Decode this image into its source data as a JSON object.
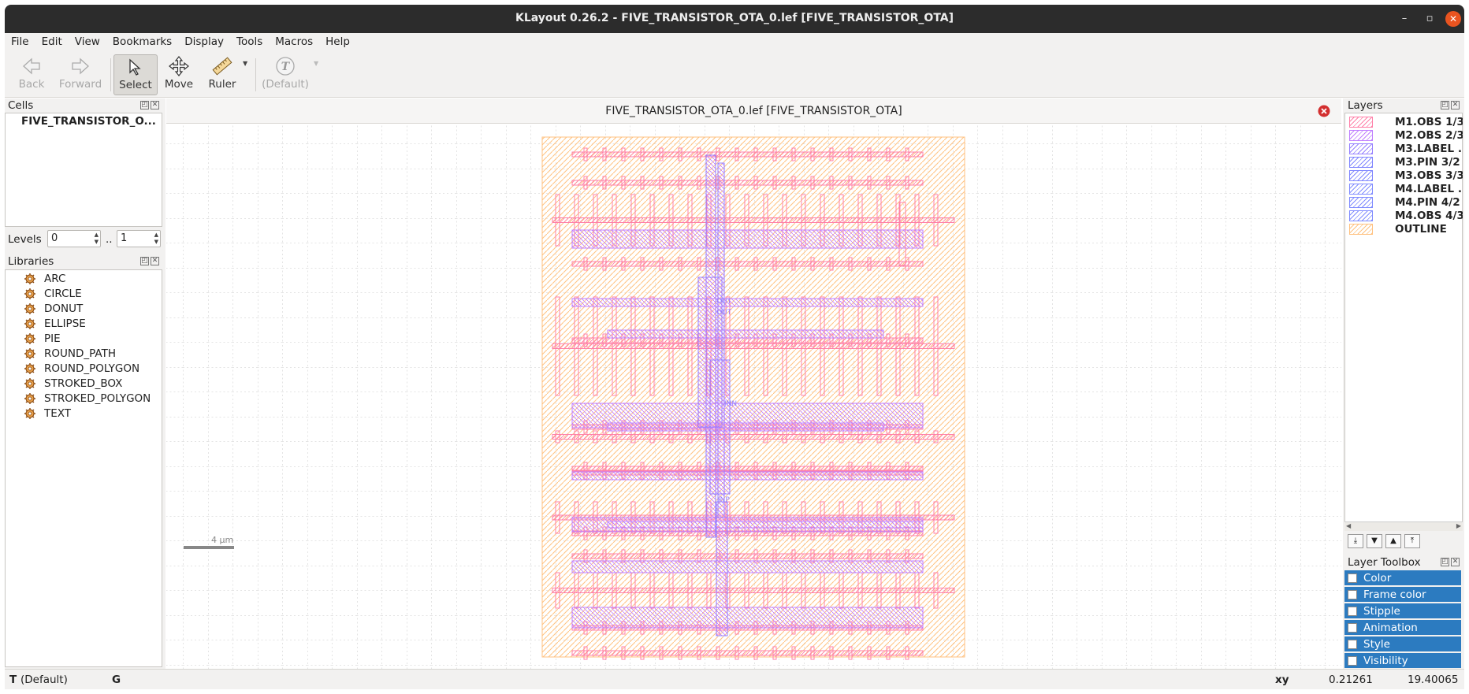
{
  "window": {
    "title": "KLayout 0.26.2 - FIVE_TRANSISTOR_OTA_0.lef [FIVE_TRANSISTOR_OTA]",
    "minimize": "–",
    "maximize": "▫",
    "close": "✕"
  },
  "menu": [
    "File",
    "Edit",
    "View",
    "Bookmarks",
    "Display",
    "Tools",
    "Macros",
    "Help"
  ],
  "toolbar": {
    "back": "Back",
    "forward": "Forward",
    "select": "Select",
    "move": "Move",
    "ruler": "Ruler",
    "text_default": "(Default)"
  },
  "cells": {
    "title": "Cells",
    "items": [
      "FIVE_TRANSISTOR_O..."
    ]
  },
  "levels": {
    "label": "Levels",
    "from": "0",
    "to": "1",
    "separator": ".."
  },
  "libraries": {
    "title": "Libraries",
    "items": [
      "ARC",
      "CIRCLE",
      "DONUT",
      "ELLIPSE",
      "PIE",
      "ROUND_PATH",
      "ROUND_POLYGON",
      "STROKED_BOX",
      "STROKED_POLYGON",
      "TEXT"
    ]
  },
  "view": {
    "title": "FIVE_TRANSISTOR_OTA_0.lef [FIVE_TRANSISTOR_OTA]",
    "scale_label": "4  µm"
  },
  "layers": {
    "title": "Layers",
    "items": [
      {
        "name": "M1.OBS 1/3",
        "color": "#ff80a8"
      },
      {
        "name": "M2.OBS 2/3",
        "color": "#c080ff"
      },
      {
        "name": "M3.LABEL ...",
        "color": "#9580ff"
      },
      {
        "name": "M3.PIN 3/2",
        "color": "#8086ff"
      },
      {
        "name": "M3.OBS 3/3",
        "color": "#8086ff"
      },
      {
        "name": "M4.LABEL ...",
        "color": "#808cff"
      },
      {
        "name": "M4.PIN 4/2",
        "color": "#808cff"
      },
      {
        "name": "M4.OBS 4/3",
        "color": "#808cff"
      },
      {
        "name": "OUTLINE",
        "color": "#ffc280"
      }
    ]
  },
  "layer_toolbox": {
    "title": "Layer Toolbox",
    "items": [
      "Color",
      "Frame color",
      "Stipple",
      "Animation",
      "Style",
      "Visibility"
    ]
  },
  "status": {
    "mode": "T",
    "mode_value": "(Default)",
    "grid": "G",
    "xy_label": "xy",
    "x": "0.21261",
    "y": "19.40065"
  },
  "colors": {
    "m1": "#ff80a8",
    "m2": "#c080ff",
    "m3": "#9580ff",
    "outline": "#ffc280",
    "accent": "#2c7bc0"
  }
}
